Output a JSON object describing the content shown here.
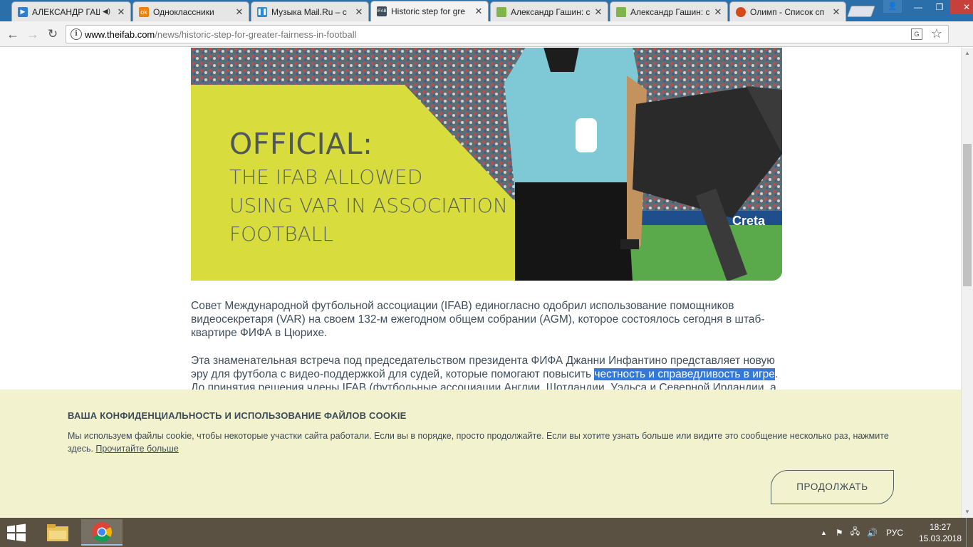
{
  "browser": {
    "tabs": [
      {
        "title": "АЛЕКСАНДР ГАШ",
        "favicon": "video-play-icon",
        "color": "#2f7fd1",
        "audio": true
      },
      {
        "title": "Одноклассники",
        "favicon": "odnoklassniki-icon",
        "color": "#ee8208",
        "audio": false
      },
      {
        "title": "Музыка Mail.Ru – с",
        "favicon": "pause-icon",
        "color": "#2a8bd8",
        "audio": false
      },
      {
        "title": "Historic step for gre",
        "favicon": "ifab-logo-icon",
        "color": "#3d4e5b",
        "audio": false,
        "active": true
      },
      {
        "title": "Александр Гашин: с",
        "favicon": "document-icon",
        "color": "#7fb449",
        "audio": false
      },
      {
        "title": "Александр Гашин: с",
        "favicon": "document-icon",
        "color": "#7fb449",
        "audio": false
      },
      {
        "title": "Олимп - Список сп",
        "favicon": "olimp-icon",
        "color": "#d64a1a",
        "audio": false
      }
    ],
    "url_host": "www.theifab.com",
    "url_path": "/news/historic-step-for-greater-fairness-in-football"
  },
  "hero": {
    "official": "OFFICIAL:",
    "line1": "THE IFAB ALLOWED",
    "line2": "USING VAR IN ASSOCIATION",
    "line3": "FOOTBALL",
    "accent_color": "#d8dc3c",
    "shirt_color": "#7fc9d6"
  },
  "article": {
    "p1": "Совет Международной футбольной ассоциации (IFAB) единогласно одобрил использование помощников видеосекретаря (VAR) на своем 132-м ежегодном общем собрании (AGM), которое состоялось сегодня в штаб-квартире ФИФА в Цюрихе.",
    "p2_before": "Эта знаменательная встреча под председательством президента ФИФА Джанни Инфантино представляет новую эру для футбола с видео-поддержкой для судей, которые помогают повысить ",
    "p2_highlight": "честность и справедливость в игре",
    "p2_after": ". До принятия решения члены IFAB (футбольные ассоциации Англии, Шотландии, Уэльса и Северной Ирландии, а"
  },
  "cookie": {
    "title": "ВАША КОНФИДЕНЦИАЛЬНОСТЬ И ИСПОЛЬЗОВАНИЕ ФАЙЛОВ COOKIE",
    "text": "Мы используем файлы cookie, чтобы некоторые участки сайта работали. Если вы в порядке, просто продолжайте. Если вы хотите узнать больше или видите это сообщение несколько раз, нажмите здесь. ",
    "link": "Прочитайте больше",
    "button": "ПРОДОЛЖАТЬ",
    "background": "#f2f2cf"
  },
  "taskbar": {
    "language": "РУС",
    "time": "18:27",
    "date": "15.03.2018"
  }
}
